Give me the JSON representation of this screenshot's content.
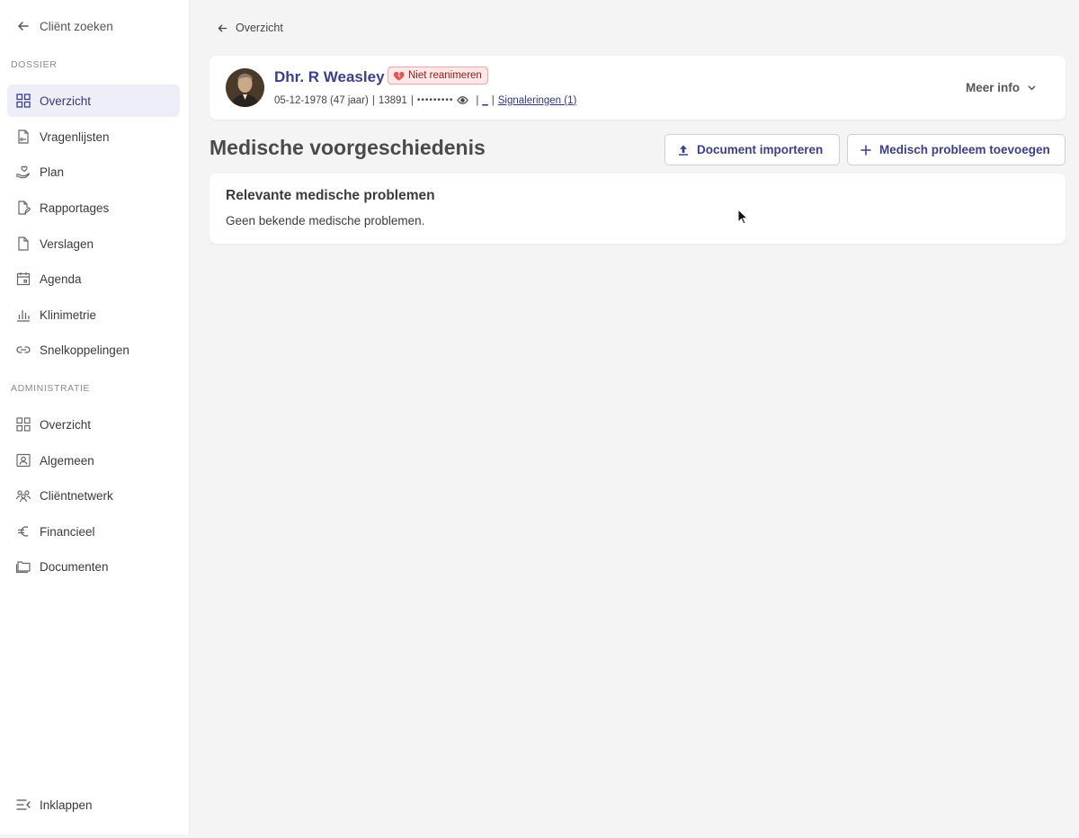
{
  "sidebar": {
    "back_label": "Cliënt zoeken",
    "sections": [
      {
        "title": "DOSSIER",
        "items": [
          {
            "label": "Overzicht",
            "icon": "grid-icon",
            "active": true
          },
          {
            "label": "Vragenlijsten",
            "icon": "questionnaire-icon"
          },
          {
            "label": "Plan",
            "icon": "hand-heart-icon"
          },
          {
            "label": "Rapportages",
            "icon": "report-edit-icon"
          },
          {
            "label": "Verslagen",
            "icon": "document-icon"
          },
          {
            "label": "Agenda",
            "icon": "calendar-icon"
          },
          {
            "label": "Klinimetrie",
            "icon": "bar-chart-icon"
          },
          {
            "label": "Snelkoppelingen",
            "icon": "link-icon"
          }
        ]
      },
      {
        "title": "ADMINISTRATIE",
        "items": [
          {
            "label": "Overzicht",
            "icon": "grid-icon"
          },
          {
            "label": "Algemeen",
            "icon": "id-card-icon"
          },
          {
            "label": "Cliëntnetwerk",
            "icon": "network-icon"
          },
          {
            "label": "Financieel",
            "icon": "euro-icon"
          },
          {
            "label": "Documenten",
            "icon": "folder-icon"
          }
        ]
      }
    ],
    "collapse_label": "Inklappen"
  },
  "breadcrumb": {
    "label": "Overzicht"
  },
  "client": {
    "name": "Dhr. R Weasley",
    "badge": "Niet reanimeren",
    "birth": "05-12-1978 (47 jaar)",
    "sep1": "|",
    "client_number": "13891",
    "sep2": "|",
    "masked_id": "•••••••••",
    "sep3": "|",
    "underscore_link": "_",
    "sep4": "|",
    "signals_link": "Signaleringen (1)",
    "more_info": "Meer info"
  },
  "page": {
    "title": "Medische voorgeschiedenis",
    "import_button": "Document importeren",
    "add_button": "Medisch probleem toevoegen"
  },
  "problems": {
    "title": "Relevante medische problemen",
    "empty_text": "Geen bekende medische problemen."
  },
  "colors": {
    "accent": "#3b3f86",
    "active_bg": "#eeeef8",
    "badge_bg": "#fde7e7",
    "badge_border": "#e9a7a7",
    "page_bg": "#f4f4f4"
  }
}
